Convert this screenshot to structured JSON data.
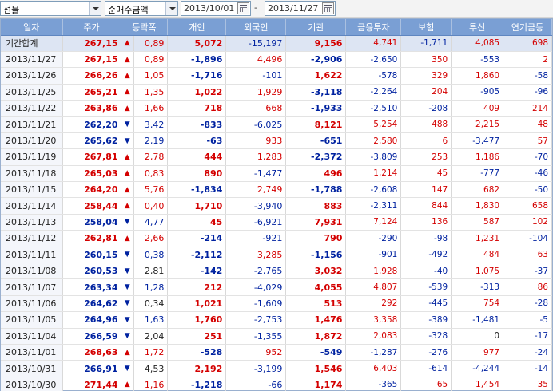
{
  "toolbar": {
    "market": "선물",
    "type": "순매수금액",
    "start_date": "2013/10/01",
    "end_date": "2013/11/27",
    "separator": "-"
  },
  "colors": {
    "up": "#d40000",
    "down": "#0022a0",
    "header_bg": "#7a9fd4",
    "total_bg": "#dde5f3"
  },
  "table": {
    "headers": [
      "일자",
      "주가",
      "등락폭",
      "",
      "개인",
      "외국인",
      "기관",
      "금융투자",
      "보험",
      "투신",
      "연기금등"
    ],
    "rows": [
      {
        "date": "기간합계",
        "price": "267,15",
        "pdir": "up",
        "arrow": "▲",
        "chg": "0,89",
        "cdir": "up",
        "ind": "5,072",
        "fgn": "-15,197",
        "inst": "9,156",
        "fin": "4,741",
        "ins": "-1,711",
        "trust": "4,085",
        "pen": "698",
        "total": true
      },
      {
        "date": "2013/11/27",
        "price": "267,15",
        "pdir": "up",
        "arrow": "▲",
        "chg": "0,89",
        "cdir": "up",
        "ind": "-1,896",
        "fgn": "4,496",
        "inst": "-2,906",
        "fin": "-2,650",
        "ins": "350",
        "trust": "-553",
        "pen": "2"
      },
      {
        "date": "2013/11/26",
        "price": "266,26",
        "pdir": "up",
        "arrow": "▲",
        "chg": "1,05",
        "cdir": "up",
        "ind": "-1,716",
        "fgn": "-101",
        "inst": "1,622",
        "fin": "-578",
        "ins": "329",
        "trust": "1,860",
        "pen": "-58"
      },
      {
        "date": "2013/11/25",
        "price": "265,21",
        "pdir": "up",
        "arrow": "▲",
        "chg": "1,35",
        "cdir": "up",
        "ind": "1,022",
        "fgn": "1,929",
        "inst": "-3,118",
        "fin": "-2,264",
        "ins": "204",
        "trust": "-905",
        "pen": "-96"
      },
      {
        "date": "2013/11/22",
        "price": "263,86",
        "pdir": "up",
        "arrow": "▲",
        "chg": "1,66",
        "cdir": "up",
        "ind": "718",
        "fgn": "668",
        "inst": "-1,933",
        "fin": "-2,510",
        "ins": "-208",
        "trust": "409",
        "pen": "214"
      },
      {
        "date": "2013/11/21",
        "price": "262,20",
        "pdir": "down",
        "arrow": "▼",
        "chg": "3,42",
        "cdir": "down",
        "ind": "-833",
        "fgn": "-6,025",
        "inst": "8,121",
        "fin": "5,254",
        "ins": "488",
        "trust": "2,215",
        "pen": "48"
      },
      {
        "date": "2013/11/20",
        "price": "265,62",
        "pdir": "down",
        "arrow": "▼",
        "chg": "2,19",
        "cdir": "down",
        "ind": "-63",
        "fgn": "933",
        "inst": "-651",
        "fin": "2,580",
        "ins": "6",
        "trust": "-3,477",
        "pen": "57"
      },
      {
        "date": "2013/11/19",
        "price": "267,81",
        "pdir": "up",
        "arrow": "▲",
        "chg": "2,78",
        "cdir": "up",
        "ind": "444",
        "fgn": "1,283",
        "inst": "-2,372",
        "fin": "-3,809",
        "ins": "253",
        "trust": "1,186",
        "pen": "-70"
      },
      {
        "date": "2013/11/18",
        "price": "265,03",
        "pdir": "up",
        "arrow": "▲",
        "chg": "0,83",
        "cdir": "up",
        "ind": "890",
        "fgn": "-1,477",
        "inst": "496",
        "fin": "1,214",
        "ins": "45",
        "trust": "-777",
        "pen": "-46"
      },
      {
        "date": "2013/11/15",
        "price": "264,20",
        "pdir": "up",
        "arrow": "▲",
        "chg": "5,76",
        "cdir": "up",
        "ind": "-1,834",
        "fgn": "2,749",
        "inst": "-1,788",
        "fin": "-2,608",
        "ins": "147",
        "trust": "682",
        "pen": "-50"
      },
      {
        "date": "2013/11/14",
        "price": "258,44",
        "pdir": "up",
        "arrow": "▲",
        "chg": "0,40",
        "cdir": "up",
        "ind": "1,710",
        "fgn": "-3,940",
        "inst": "883",
        "fin": "-2,311",
        "ins": "844",
        "trust": "1,830",
        "pen": "658"
      },
      {
        "date": "2013/11/13",
        "price": "258,04",
        "pdir": "down",
        "arrow": "▼",
        "chg": "4,77",
        "cdir": "down",
        "ind": "45",
        "fgn": "-6,921",
        "inst": "7,931",
        "fin": "7,124",
        "ins": "136",
        "trust": "587",
        "pen": "102"
      },
      {
        "date": "2013/11/12",
        "price": "262,81",
        "pdir": "up",
        "arrow": "▲",
        "chg": "2,66",
        "cdir": "up",
        "ind": "-214",
        "fgn": "-921",
        "inst": "790",
        "fin": "-290",
        "ins": "-98",
        "trust": "1,231",
        "pen": "-104"
      },
      {
        "date": "2013/11/11",
        "price": "260,15",
        "pdir": "down",
        "arrow": "▼",
        "chg": "0,38",
        "cdir": "down",
        "ind": "-2,112",
        "fgn": "3,285",
        "inst": "-1,156",
        "fin": "-901",
        "ins": "-492",
        "trust": "484",
        "pen": "63"
      },
      {
        "date": "2013/11/08",
        "price": "260,53",
        "pdir": "down",
        "arrow": "▼",
        "chg": "2,81",
        "cdir": "flat",
        "ind": "-142",
        "fgn": "-2,765",
        "inst": "3,032",
        "fin": "1,928",
        "ins": "-40",
        "trust": "1,075",
        "pen": "-37"
      },
      {
        "date": "2013/11/07",
        "price": "263,34",
        "pdir": "down",
        "arrow": "▼",
        "chg": "1,28",
        "cdir": "down",
        "ind": "212",
        "fgn": "-4,029",
        "inst": "4,055",
        "fin": "4,807",
        "ins": "-539",
        "trust": "-313",
        "pen": "86"
      },
      {
        "date": "2013/11/06",
        "price": "264,62",
        "pdir": "down",
        "arrow": "▼",
        "chg": "0,34",
        "cdir": "flat",
        "ind": "1,021",
        "fgn": "-1,609",
        "inst": "513",
        "fin": "292",
        "ins": "-445",
        "trust": "754",
        "pen": "-28"
      },
      {
        "date": "2013/11/05",
        "price": "264,96",
        "pdir": "down",
        "arrow": "▼",
        "chg": "1,63",
        "cdir": "down",
        "ind": "1,760",
        "fgn": "-2,753",
        "inst": "1,476",
        "fin": "3,358",
        "ins": "-389",
        "trust": "-1,481",
        "pen": "-5"
      },
      {
        "date": "2013/11/04",
        "price": "266,59",
        "pdir": "down",
        "arrow": "▼",
        "chg": "2,04",
        "cdir": "flat",
        "ind": "251",
        "fgn": "-1,355",
        "inst": "1,872",
        "fin": "2,083",
        "ins": "-328",
        "trust": "0",
        "pen": "-17"
      },
      {
        "date": "2013/11/01",
        "price": "268,63",
        "pdir": "up",
        "arrow": "▲",
        "chg": "1,72",
        "cdir": "up",
        "ind": "-528",
        "fgn": "952",
        "inst": "-549",
        "fin": "-1,287",
        "ins": "-276",
        "trust": "977",
        "pen": "-24"
      },
      {
        "date": "2013/10/31",
        "price": "266,91",
        "pdir": "down",
        "arrow": "▼",
        "chg": "4,53",
        "cdir": "flat",
        "ind": "2,192",
        "fgn": "-3,199",
        "inst": "1,546",
        "fin": "6,403",
        "ins": "-614",
        "trust": "-4,244",
        "pen": "-14"
      },
      {
        "date": "2013/10/30",
        "price": "271,44",
        "pdir": "up",
        "arrow": "▲",
        "chg": "1,16",
        "cdir": "up",
        "ind": "-1,218",
        "fgn": "-66",
        "inst": "1,174",
        "fin": "-365",
        "ins": "65",
        "trust": "1,454",
        "pen": "35"
      }
    ]
  }
}
